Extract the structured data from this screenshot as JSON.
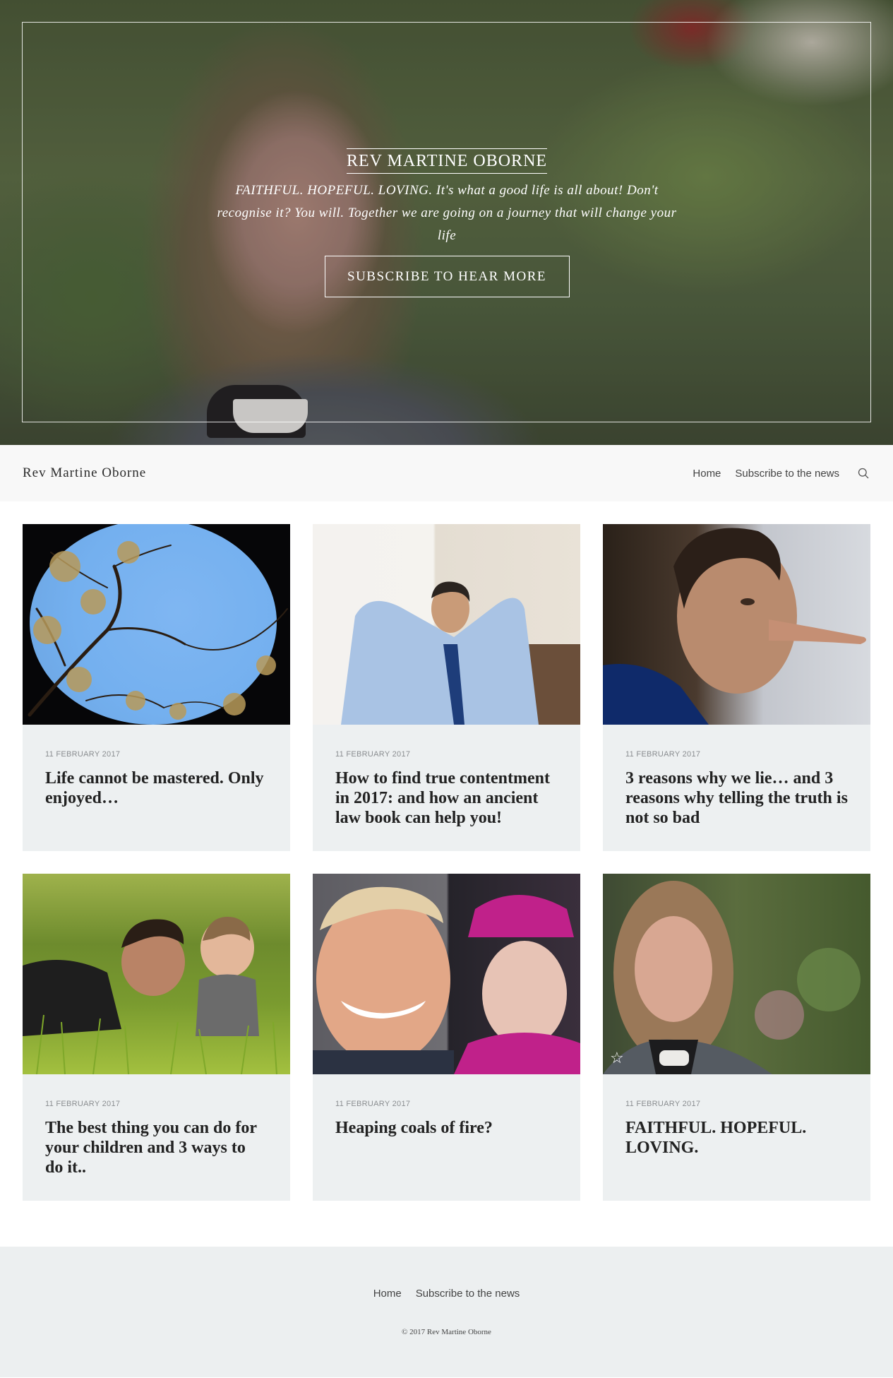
{
  "hero": {
    "title": "REV MARTINE OBORNE",
    "tagline": "FAITHFUL. HOPEFUL. LOVING. It's what a good life is all about! Don't recognise it? You will. Together we are going on a journey that will change your life",
    "button_label": "SUBSCRIBE TO HEAR MORE"
  },
  "header": {
    "site_name": "Rev Martine Oborne",
    "nav": [
      {
        "label": "Home"
      },
      {
        "label": "Subscribe to the news"
      }
    ],
    "search_icon": "search-icon"
  },
  "posts": [
    {
      "date": "11 FEBRUARY 2017",
      "title": "Life cannot be mastered. Only enjoyed…",
      "image": "tree-canopy-sky"
    },
    {
      "date": "11 FEBRUARY 2017",
      "title": "How to find true contentment in 2017: and how an ancient law book can help you!",
      "image": "relaxed-businessman"
    },
    {
      "date": "11 FEBRUARY 2017",
      "title": "3 reasons why we lie… and 3 reasons why telling the truth is not so bad",
      "image": "man-long-nose"
    },
    {
      "date": "11 FEBRUARY 2017",
      "title": "The best thing you can do for your children and 3 ways to do it..",
      "image": "father-baby-grass"
    },
    {
      "date": "11 FEBRUARY 2017",
      "title": "Heaping coals of fire?",
      "image": "politician-and-queen"
    },
    {
      "date": "11 FEBRUARY 2017",
      "title": "FAITHFUL. HOPEFUL. LOVING.",
      "image": "reverend-portrait",
      "featured_icon": "star-icon"
    }
  ],
  "footer": {
    "nav": [
      {
        "label": "Home"
      },
      {
        "label": "Subscribe to the news"
      }
    ],
    "copyright": "© 2017 Rev Martine Oborne"
  }
}
